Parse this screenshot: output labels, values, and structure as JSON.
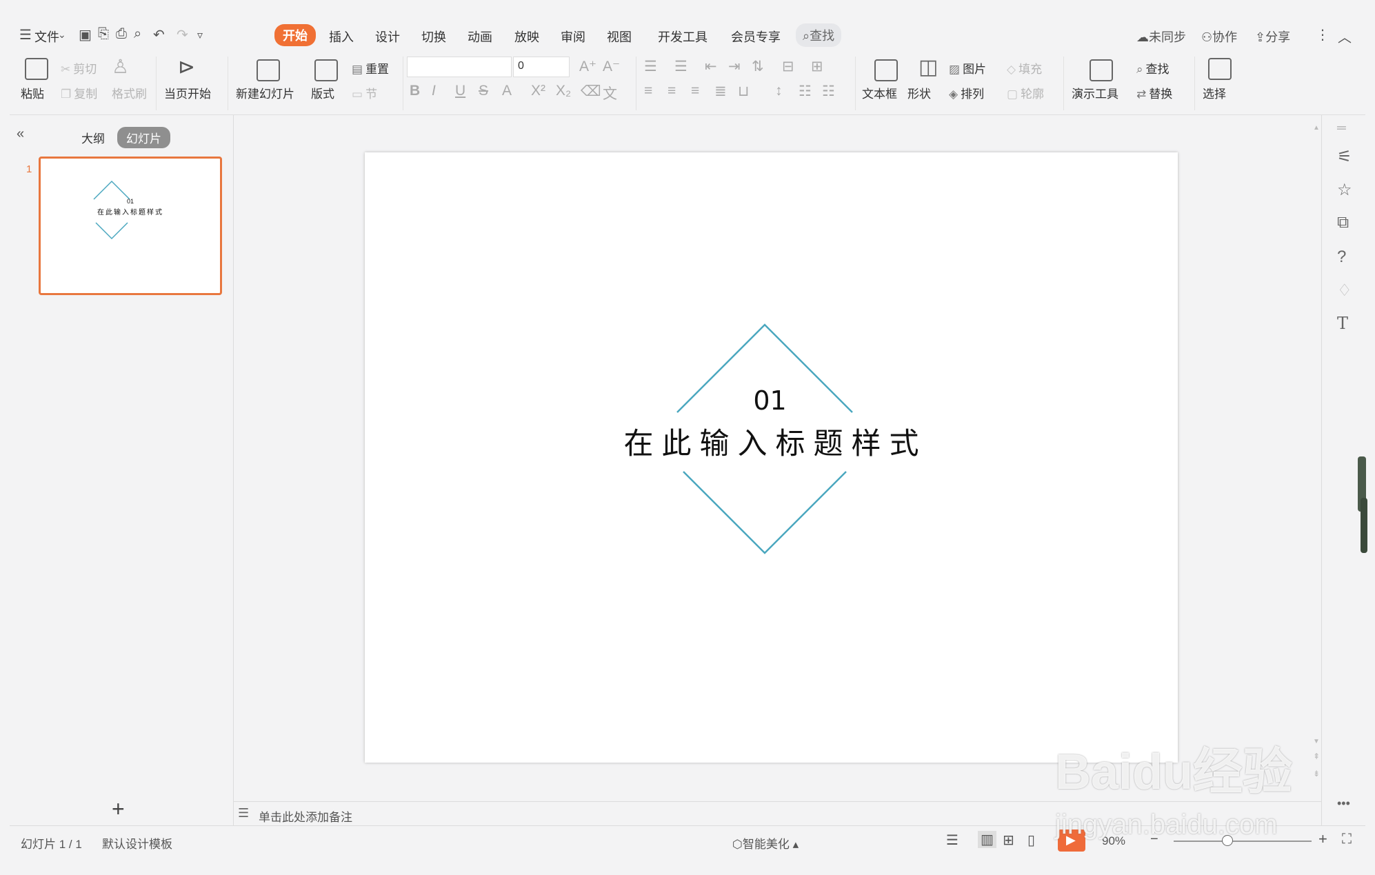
{
  "menubar": {
    "file": "文件",
    "tabs": [
      "开始",
      "插入",
      "设计",
      "切换",
      "动画",
      "放映",
      "审阅",
      "视图",
      "开发工具",
      "会员专享"
    ],
    "search": "查找",
    "sync": "未同步",
    "collab": "协作",
    "share": "分享"
  },
  "ribbon": {
    "paste": "粘贴",
    "cut": "剪切",
    "copy": "复制",
    "format_painter": "格式刷",
    "start_from_current": "当页开始",
    "new_slide": "新建幻灯片",
    "layout": "版式",
    "reset": "重置",
    "section": "节",
    "font_name": "",
    "font_size": "0",
    "textbox": "文本框",
    "shape": "形状",
    "picture": "图片",
    "fill": "填充",
    "arrange": "排列",
    "outline": "轮廓",
    "presenter_tools": "演示工具",
    "find": "查找",
    "replace": "替换",
    "select": "选择"
  },
  "leftpane": {
    "outline_tab": "大纲",
    "slides_tab": "幻灯片",
    "slide_number": "1",
    "thumb_num": "01",
    "thumb_title": "在此输入标题样式",
    "add": "+"
  },
  "slide": {
    "number": "01",
    "title": "在此输入标题样式",
    "accent_color": "#4aa7bf"
  },
  "notes": {
    "placeholder": "单击此处添加备注"
  },
  "statusbar": {
    "slide_info": "幻灯片 1 / 1",
    "template": "默认设计模板",
    "smart_beautify": "智能美化",
    "zoom": "90%"
  },
  "watermark": {
    "brand": "Baidu经验",
    "url": "jingyan.baidu.com"
  }
}
